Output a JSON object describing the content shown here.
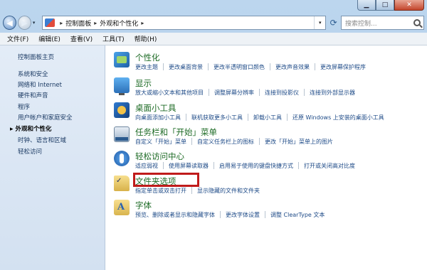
{
  "titlebar": {
    "minimize": "▁",
    "maximize": "□",
    "close": "✕"
  },
  "nav": {
    "back": "◀",
    "forward": "▶",
    "dropdown": "▾",
    "breadcrumb_sep": "▸",
    "breadcrumbs": [
      "控制面板",
      "外观和个性化"
    ],
    "refresh": "⟳",
    "search_placeholder": "搜索控制..."
  },
  "menu": [
    "文件(F)",
    "编辑(E)",
    "查看(V)",
    "工具(T)",
    "帮助(H)"
  ],
  "sidebar": {
    "items": [
      {
        "label": "控制面板主页",
        "current": false
      },
      {
        "label": "系统和安全",
        "current": false
      },
      {
        "label": "网络和 Internet",
        "current": false
      },
      {
        "label": "硬件和声音",
        "current": false
      },
      {
        "label": "程序",
        "current": false
      },
      {
        "label": "用户帐户和家庭安全",
        "current": false
      },
      {
        "label": "外观和个性化",
        "current": true
      },
      {
        "label": "时钟、语言和区域",
        "current": false
      },
      {
        "label": "轻松访问",
        "current": false
      }
    ]
  },
  "categories": [
    {
      "title": "个性化",
      "icon": "personalization-icon",
      "links": [
        "更改主题",
        "更改桌面背景",
        "更改半透明窗口颜色",
        "更改声音效果",
        "更改屏幕保护程序"
      ]
    },
    {
      "title": "显示",
      "icon": "display-icon",
      "links": [
        "放大或缩小文本和其他项目",
        "调整屏幕分辨率",
        "连接到投影仪",
        "连接到外部显示器"
      ]
    },
    {
      "title": "桌面小工具",
      "icon": "gadgets-icon",
      "links": [
        "向桌面添加小工具",
        "联机获取更多小工具",
        "卸载小工具",
        "还原 Windows 上安装的桌面小工具"
      ]
    },
    {
      "title": "任务栏和「开始」菜单",
      "icon": "taskbar-icon",
      "links": [
        "自定义「开始」菜单",
        "自定义任务栏上的图标",
        "更改「开始」菜单上的图片"
      ]
    },
    {
      "title": "轻松访问中心",
      "icon": "ease-of-access-icon",
      "links": [
        "适应弱视",
        "使用屏幕读取器",
        "启用易于使用的键盘快捷方式",
        "打开或关闭高对比度"
      ]
    },
    {
      "title": "文件夹选项",
      "icon": "folder-options-icon",
      "links": [
        "指定单击或双击打开",
        "显示隐藏的文件和文件夹"
      ]
    },
    {
      "title": "字体",
      "icon": "fonts-icon",
      "links": [
        "预览、删除或者显示和隐藏字体",
        "更改字体设置",
        "调整 ClearType 文本"
      ]
    }
  ],
  "colors": {
    "category_title": "#1c6a24",
    "link": "#1d4a87",
    "highlight_box": "#c01b1b"
  }
}
